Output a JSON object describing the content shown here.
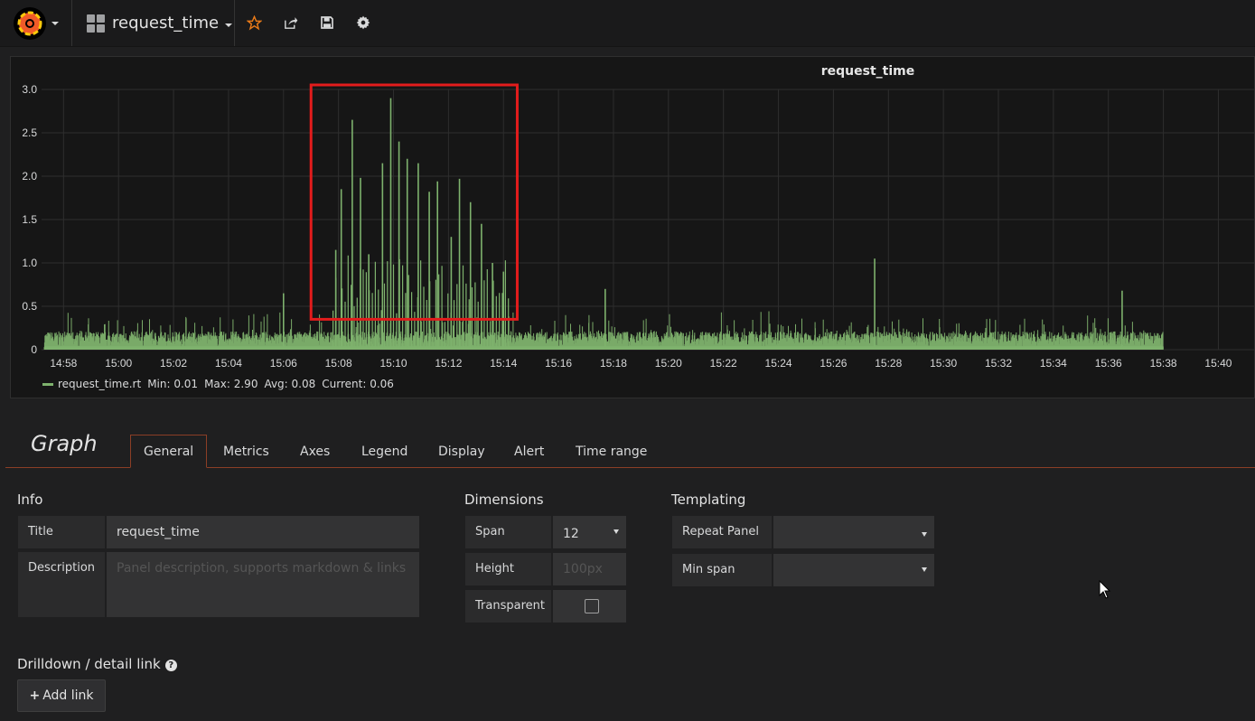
{
  "navbar": {
    "dashboard_title": "request_time",
    "icons": [
      "grafana-logo-icon",
      "star-icon",
      "share-icon",
      "save-icon",
      "gear-icon"
    ]
  },
  "panel": {
    "title": "request_time",
    "legend": {
      "series": "request_time.rt",
      "min": "Min: 0.01",
      "max": "Max: 2.90",
      "avg": "Avg: 0.08",
      "current": "Current: 0.06"
    }
  },
  "chart_data": {
    "type": "line",
    "title": "request_time",
    "y_ticks": [
      "0",
      "0.5",
      "1.0",
      "1.5",
      "2.0",
      "2.5",
      "3.0"
    ],
    "ylim": [
      0,
      3.0
    ],
    "x_ticks": [
      "14:58",
      "15:00",
      "15:02",
      "15:04",
      "15:06",
      "15:08",
      "15:10",
      "15:12",
      "15:14",
      "15:16",
      "15:18",
      "15:20",
      "15:22",
      "15:24",
      "15:26",
      "15:28",
      "15:30",
      "15:32",
      "15:34",
      "15:36",
      "15:38",
      "15:40"
    ],
    "series": [
      {
        "name": "request_time.rt",
        "color": "#7eb26d",
        "spikes": [
          {
            "t": "15:07.9",
            "v": 1.15
          },
          {
            "t": "15:08.1",
            "v": 1.85
          },
          {
            "t": "15:08.5",
            "v": 2.65
          },
          {
            "t": "15:08.8",
            "v": 1.98
          },
          {
            "t": "15:09.1",
            "v": 1.1
          },
          {
            "t": "15:09.6",
            "v": 2.15
          },
          {
            "t": "15:09.9",
            "v": 2.9
          },
          {
            "t": "15:10.2",
            "v": 2.4
          },
          {
            "t": "15:10.5",
            "v": 2.2
          },
          {
            "t": "15:10.9",
            "v": 2.15
          },
          {
            "t": "15:11.3",
            "v": 1.82
          },
          {
            "t": "15:11.6",
            "v": 1.94
          },
          {
            "t": "15:12.1",
            "v": 1.3
          },
          {
            "t": "15:12.4",
            "v": 1.97
          },
          {
            "t": "15:12.8",
            "v": 1.7
          },
          {
            "t": "15:13.2",
            "v": 1.45
          },
          {
            "t": "15:13.6",
            "v": 1.0
          },
          {
            "t": "15:14.0",
            "v": 0.9
          },
          {
            "t": "15:06.0",
            "v": 0.65
          },
          {
            "t": "15:17.7",
            "v": 0.7
          },
          {
            "t": "15:27.5",
            "v": 1.05
          },
          {
            "t": "15:36.5",
            "v": 0.68
          }
        ],
        "baseline_range": [
          0.01,
          0.3
        ]
      }
    ],
    "highlight_box": {
      "x_start": "15:07.0",
      "x_end": "15:14.5",
      "y_low": 0.35,
      "y_high": 3.0,
      "color": "#e31c1c"
    }
  },
  "editor": {
    "title": "Graph",
    "tabs": [
      "General",
      "Metrics",
      "Axes",
      "Legend",
      "Display",
      "Alert",
      "Time range"
    ],
    "active_tab": "General",
    "info": {
      "heading": "Info",
      "title_label": "Title",
      "title_value": "request_time",
      "description_label": "Description",
      "description_placeholder": "Panel description, supports markdown & links"
    },
    "dimensions": {
      "heading": "Dimensions",
      "span_label": "Span",
      "span_value": "12",
      "height_label": "Height",
      "height_placeholder": "100px",
      "transparent_label": "Transparent"
    },
    "templating": {
      "heading": "Templating",
      "repeat_label": "Repeat Panel",
      "repeat_value": "",
      "minspan_label": "Min span",
      "minspan_value": ""
    },
    "drilldown": {
      "heading": "Drilldown / detail link",
      "help": "?",
      "add_link": "Add link"
    }
  }
}
